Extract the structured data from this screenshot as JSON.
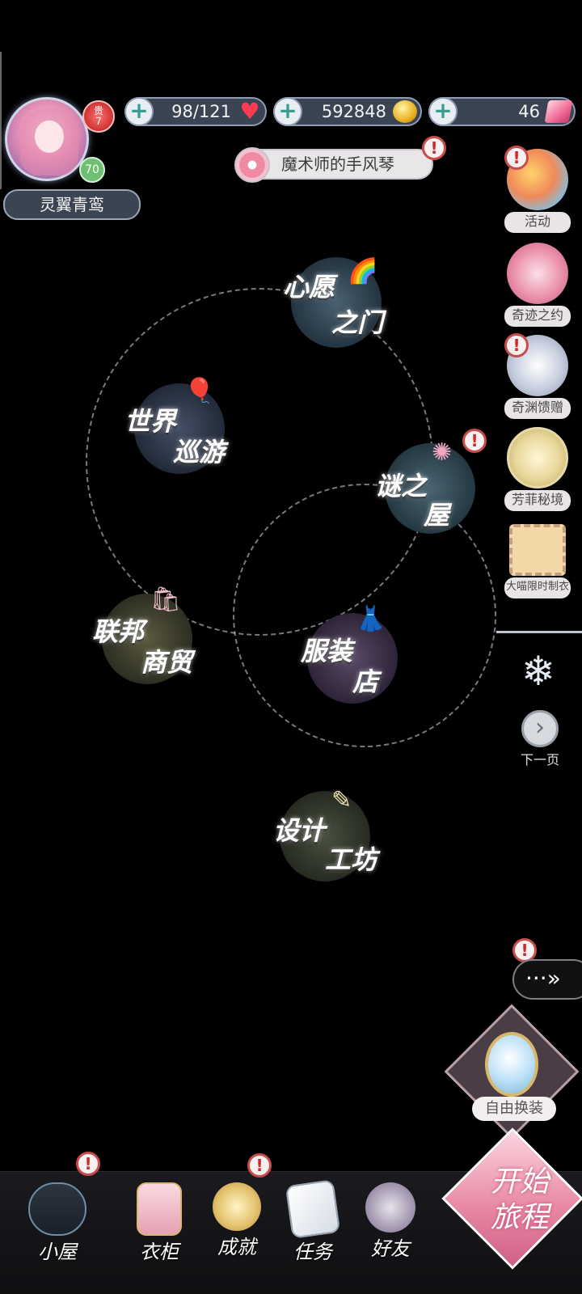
{
  "player": {
    "name": "灵翼青鸾",
    "vip_label": "贵",
    "vip_level": "7",
    "level": "70"
  },
  "resources": {
    "stamina": "98/121",
    "coins": "592848",
    "diamonds": "46"
  },
  "song": {
    "title": "魔术师的手风琴"
  },
  "side_menu": [
    {
      "label": "活动",
      "icon": "balloons-icon"
    },
    {
      "label": "奇迹之约",
      "icon": "girl-portrait-icon"
    },
    {
      "label": "奇渊馈赠",
      "icon": "shell-pearl-icon"
    },
    {
      "label": "芳菲秘境",
      "icon": "butterfly-icon"
    },
    {
      "label": "大喵限时制衣",
      "icon": "cat-stamp-icon"
    }
  ],
  "next_page_label": "下一页",
  "map_nodes": [
    {
      "line1": "心愿",
      "line2": "之门"
    },
    {
      "line1": "世界",
      "line2": "巡游"
    },
    {
      "line1": "谜之",
      "line2": "屋"
    },
    {
      "line1": "联邦",
      "line2": "商贸"
    },
    {
      "line1": "服装",
      "line2": "店"
    },
    {
      "line1": "设计",
      "line2": "工坊"
    }
  ],
  "free_dress_label": "自由换装",
  "bottom_nav": [
    {
      "label": "小屋",
      "icon": "bicycle-icon"
    },
    {
      "label": "衣柜",
      "icon": "wardrobe-icon"
    },
    {
      "label": "成就",
      "icon": "medal-icon"
    },
    {
      "label": "任务",
      "icon": "task-book-icon"
    },
    {
      "label": "好友",
      "icon": "friends-icon"
    }
  ],
  "start_journey": {
    "line1": "开始",
    "line2": "旅程"
  },
  "alert_mark": "!",
  "more_label": "···»",
  "colors": {
    "accent_pink": "#e98aa6",
    "alert_red": "#c94c4c",
    "plate_bg": "#3a4452",
    "plus_teal": "#3a9b8f"
  }
}
